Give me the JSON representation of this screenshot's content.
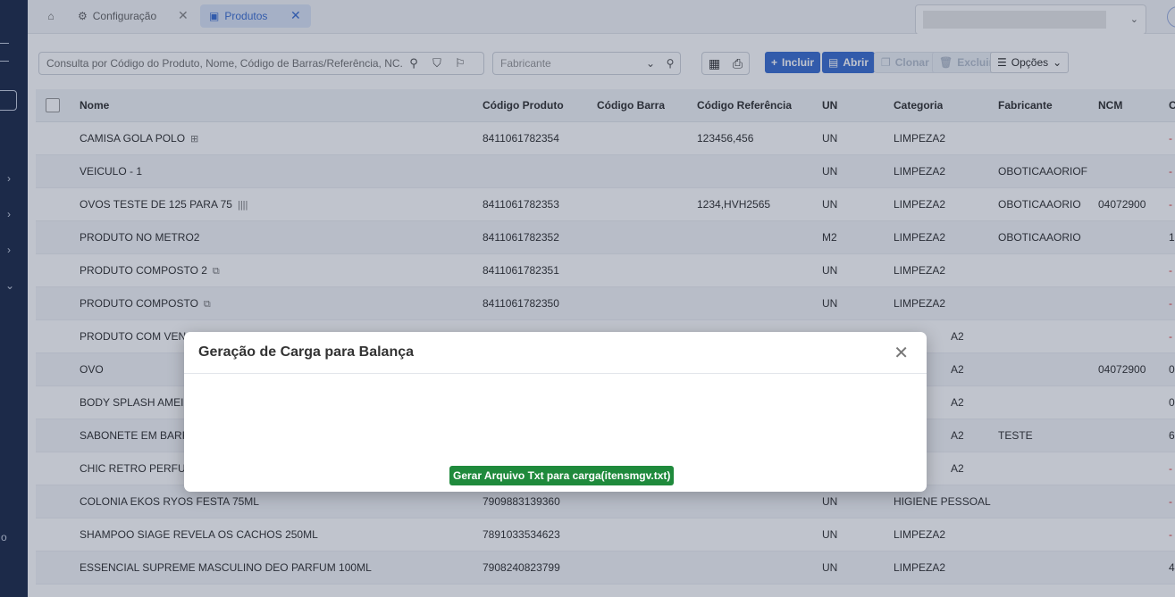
{
  "tabs": {
    "config_label": "Configuração",
    "produtos_label": "Produtos",
    "close_glyph": "✕"
  },
  "toolbar": {
    "search_placeholder": "Consulta por Código do Produto, Nome, Código de Barras/Referência, NC...",
    "manufacturer_placeholder": "Fabricante",
    "incluir_label": "Incluir",
    "abrir_label": "Abrir",
    "clonar_label": "Clonar",
    "excluir_label": "Excluir",
    "opcoes_label": "Opções"
  },
  "sidebar": {
    "bottom_fragment": "o"
  },
  "table": {
    "headers": {
      "nome": "Nome",
      "codigo_produto": "Código Produto",
      "codigo_barra": "Código Barra",
      "codigo_referencia": "Código Referência",
      "un": "UN",
      "categoria": "Categoria",
      "fabricante": "Fabricante",
      "ncm": "NCM",
      "extra": "C"
    },
    "rows": [
      {
        "nome": "CAMISA GOLA POLO",
        "cod": "8411061782354",
        "ref": "123456,456",
        "un": "UN",
        "cat": "LIMPEZA2",
        "fab": "",
        "ncm": "",
        "x": "-"
      },
      {
        "nome": "VEICULO - 1",
        "cod": "",
        "ref": "",
        "un": "UN",
        "cat": "LIMPEZA2",
        "fab": "OBOTICAAORIOF",
        "ncm": "",
        "x": "-"
      },
      {
        "nome": "OVOS TESTE DE 125 PARA 75",
        "cod": "8411061782353",
        "ref": "1234,HVH2565",
        "un": "UN",
        "cat": "LIMPEZA2",
        "fab": "OBOTICAAORIO",
        "ncm": "04072900",
        "x": "-"
      },
      {
        "nome": "PRODUTO NO METRO2",
        "cod": "8411061782352",
        "ref": "",
        "un": "M2",
        "cat": "LIMPEZA2",
        "fab": "OBOTICAAORIO",
        "ncm": "",
        "x": "1"
      },
      {
        "nome": "PRODUTO COMPOSTO 2",
        "cod": "8411061782351",
        "ref": "",
        "un": "UN",
        "cat": "LIMPEZA2",
        "fab": "",
        "ncm": "",
        "x": "-"
      },
      {
        "nome": "PRODUTO COMPOSTO",
        "cod": "8411061782350",
        "ref": "",
        "un": "UN",
        "cat": "LIMPEZA2",
        "fab": "",
        "ncm": "",
        "x": "-"
      },
      {
        "nome": "PRODUTO COM VENC",
        "cod": "",
        "ref": "",
        "un": "",
        "cat": "A2",
        "fab": "",
        "ncm": "",
        "x": "-"
      },
      {
        "nome": "OVO",
        "cod": "",
        "ref": "",
        "un": "",
        "cat": "A2",
        "fab": "",
        "ncm": "04072900",
        "x": "0"
      },
      {
        "nome": "BODY SPLASH AMEIXA",
        "cod": "",
        "ref": "",
        "un": "",
        "cat": "A2",
        "fab": "",
        "ncm": "",
        "x": "0"
      },
      {
        "nome": "SABONETE EM BARRA",
        "cod": "",
        "ref": "",
        "un": "",
        "cat": "A2",
        "fab": "TESTE",
        "ncm": "",
        "x": "6"
      },
      {
        "nome": "CHIC RETRO PERFUME",
        "cod": "",
        "ref": "",
        "un": "",
        "cat": "A2",
        "fab": "",
        "ncm": "",
        "x": "-"
      },
      {
        "nome": "COLONIA EKOS RYOS FESTA 75ML",
        "cod": "7909883139360",
        "ref": "",
        "un": "UN",
        "cat": "HIGIENE PESSOAL",
        "fab": "",
        "ncm": "",
        "x": "-"
      },
      {
        "nome": "SHAMPOO SIAGE REVELA OS CACHOS 250ML",
        "cod": "7891033534623",
        "ref": "",
        "un": "UN",
        "cat": "LIMPEZA2",
        "fab": "",
        "ncm": "",
        "x": "-"
      },
      {
        "nome": "ESSENCIAL SUPREME MASCULINO DEO PARFUM 100ML",
        "cod": "7908240823799",
        "ref": "",
        "un": "UN",
        "cat": "LIMPEZA2",
        "fab": "",
        "ncm": "",
        "x": "4"
      }
    ]
  },
  "modal": {
    "title": "Geração de Carga para Balança",
    "close_glyph": "✕",
    "generate_button": "Gerar Arquivo Txt para carga(itensmgv.txt)"
  }
}
